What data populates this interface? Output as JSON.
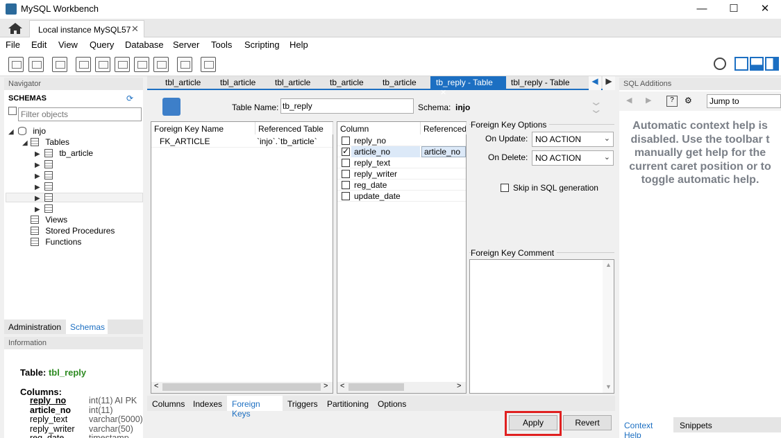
{
  "window": {
    "title": "MySQL Workbench",
    "minimize": "—",
    "maximize": "☐",
    "close": "✕"
  },
  "connection_tab": {
    "label": "Local instance MySQL57",
    "close": "✕"
  },
  "menu": [
    "File",
    "Edit",
    "View",
    "Query",
    "Database",
    "Server",
    "Tools",
    "Scripting",
    "Help"
  ],
  "navigator": {
    "header": "Navigator",
    "schemas_label": "SCHEMAS",
    "filter_placeholder": "Filter objects",
    "schema": "injo",
    "tables_label": "Tables",
    "first_table": "tb_article",
    "views_label": "Views",
    "procedures_label": "Stored Procedures",
    "functions_label": "Functions",
    "tabs": [
      "Administration",
      "Schemas"
    ]
  },
  "information": {
    "header": "Information",
    "table_label": "Table:",
    "table_name": "tbl_reply",
    "columns_label": "Columns:",
    "columns": [
      {
        "name": "reply_no",
        "type": "int(11) AI PK"
      },
      {
        "name": "article_no",
        "type": "int(11)"
      },
      {
        "name": "reply_text",
        "type": "varchar(5000)"
      },
      {
        "name": "reply_writer",
        "type": "varchar(50)"
      },
      {
        "name": "reg_date",
        "type": "timestamp"
      }
    ]
  },
  "editor_tabs": [
    "tbl_article",
    "tbl_article",
    "tbl_article",
    "tb_article",
    "tb_article",
    "tb_reply - Table",
    "tbl_reply - Table"
  ],
  "active_tab_close": "✕",
  "table_editor": {
    "table_name_label": "Table Name:",
    "table_name": "tb_reply",
    "schema_label": "Schema:",
    "schema": "injo"
  },
  "fk_list": {
    "headers": [
      "Foreign Key Name",
      "Referenced Table"
    ],
    "rows": [
      {
        "name": "FK_ARTICLE",
        "ref": "`injo`.`tb_article`"
      }
    ]
  },
  "column_list": {
    "headers": [
      "Column",
      "Referenced C"
    ],
    "rows": [
      {
        "name": "reply_no",
        "checked": false,
        "ref": ""
      },
      {
        "name": "article_no",
        "checked": true,
        "ref": "article_no"
      },
      {
        "name": "reply_text",
        "checked": false,
        "ref": ""
      },
      {
        "name": "reply_writer",
        "checked": false,
        "ref": ""
      },
      {
        "name": "reg_date",
        "checked": false,
        "ref": ""
      },
      {
        "name": "update_date",
        "checked": false,
        "ref": ""
      }
    ]
  },
  "fk_options": {
    "title": "Foreign Key Options",
    "on_update_label": "On Update:",
    "on_update": "NO ACTION",
    "on_delete_label": "On Delete:",
    "on_delete": "NO ACTION",
    "skip_label": "Skip in SQL generation",
    "comment_label": "Foreign Key Comment"
  },
  "sub_tabs": [
    "Columns",
    "Indexes",
    "Foreign Keys",
    "Triggers",
    "Partitioning",
    "Options"
  ],
  "buttons": {
    "apply": "Apply",
    "revert": "Revert"
  },
  "sql_additions": {
    "header": "SQL Additions",
    "jump_to": "Jump to",
    "help_lines": [
      "Automatic context help is",
      "disabled. Use the toolbar t",
      "manually get help for the",
      "current caret position or to",
      "toggle automatic help."
    ],
    "tabs": [
      "Context Help",
      "Snippets"
    ]
  },
  "colors": {
    "accent": "#1c6fc2",
    "highlight": "#e02020",
    "table_green": "#2e8b22"
  }
}
